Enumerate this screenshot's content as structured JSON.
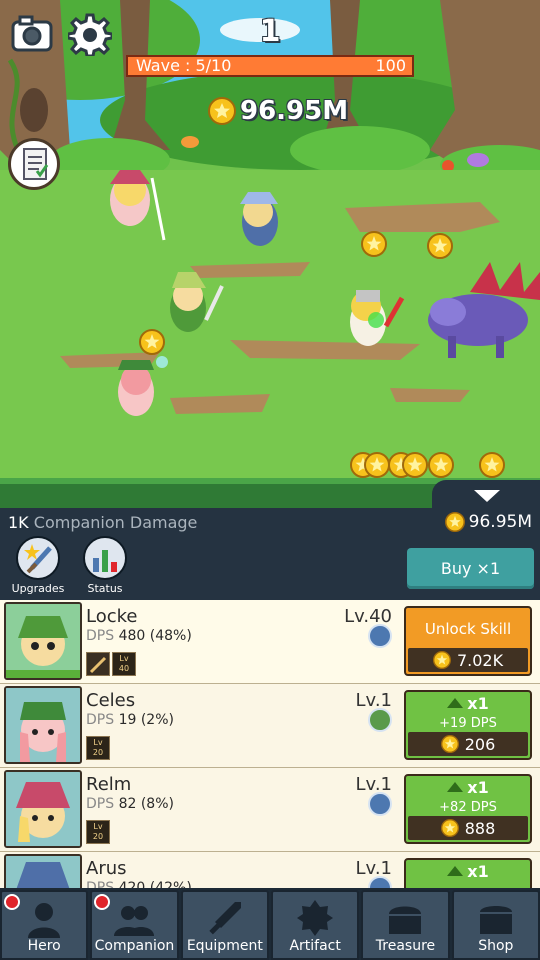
{
  "hud": {
    "wave_number": "1",
    "wave_label": "Wave : 5/10",
    "wave_hp": "100",
    "wave_fill_fraction": 1.0,
    "gold": "96.95M",
    "icons": [
      "camera-icon",
      "gear-icon",
      "quest-checklist-icon",
      "gold-coin-icon"
    ]
  },
  "infobar": {
    "damage_value": "1K",
    "damage_label": "Companion Damage",
    "gold": "96.95M",
    "upgrades_label": "Upgrades",
    "status_label": "Status",
    "buy_label": "Buy ×1"
  },
  "heroes": [
    {
      "name": "Locke",
      "dps_value": "480 (48%)",
      "level": "Lv.40",
      "badge_level": "40",
      "action_top": "Unlock Skill",
      "cost": "7.02K",
      "button_color": "#f29b25",
      "icon": "sword-skill-icon"
    },
    {
      "name": "Celes",
      "dps_value": "19 (2%)",
      "level": "Lv.1",
      "badge_level": "20",
      "mult": "x1",
      "gain": "+19 DPS",
      "cost": "206",
      "button_color": "#70c244",
      "icon": "arrow-skill-icon"
    },
    {
      "name": "Relm",
      "dps_value": "82 (8%)",
      "level": "Lv.1",
      "badge_level": "20",
      "mult": "x1",
      "gain": "+82 DPS",
      "cost": "888",
      "button_color": "#70c244",
      "icon": "sword-skill-icon"
    },
    {
      "name": "Arus",
      "dps_value": "420 (42%)",
      "level": "Lv.1",
      "mult": "x1",
      "button_color": "#70c244",
      "icon": "sword-skill-icon"
    }
  ],
  "labels": {
    "dps": "DPS",
    "badge_lv": "Lv"
  },
  "nav": [
    {
      "label": "Hero",
      "icon": "hero-icon",
      "alert": true
    },
    {
      "label": "Companion",
      "icon": "companion-icon",
      "alert": true
    },
    {
      "label": "Equipment",
      "icon": "sword-icon",
      "alert": false
    },
    {
      "label": "Artifact",
      "icon": "artifact-icon",
      "alert": false
    },
    {
      "label": "Treasure",
      "icon": "treasure-chest-icon",
      "alert": false
    },
    {
      "label": "Shop",
      "icon": "shop-icon",
      "alert": false
    }
  ],
  "colors": {
    "wave_bar": "#ff6a2c",
    "panel": "#253341",
    "buy_button": "#3fa0a0",
    "nav_tab": "#3d5062",
    "alert_dot": "#e0262c"
  }
}
